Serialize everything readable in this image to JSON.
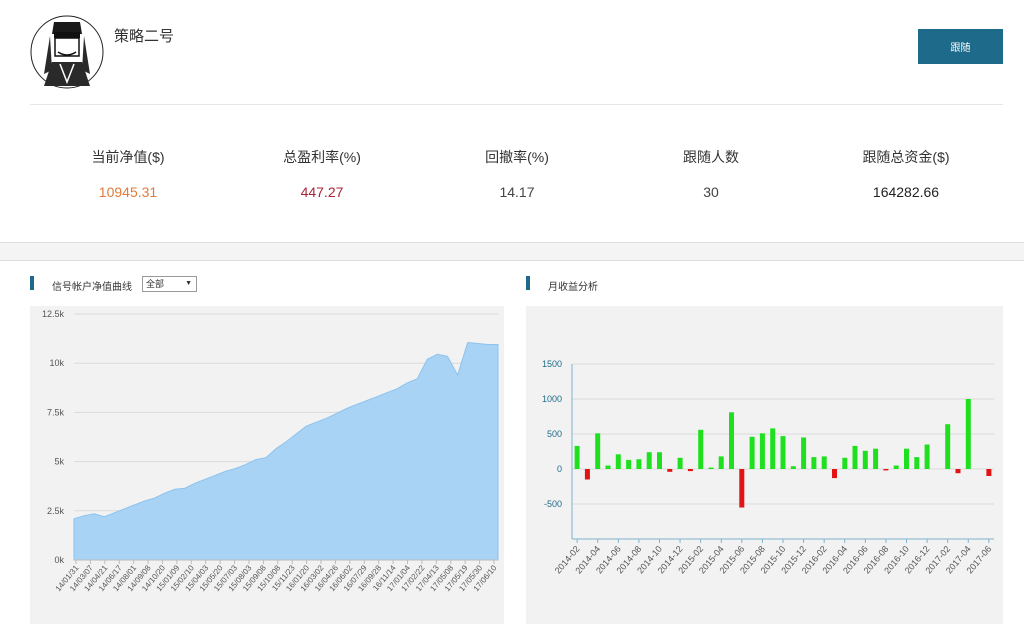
{
  "header": {
    "strategy_name": "策略二号",
    "follow_label": "跟随"
  },
  "stats": [
    {
      "label": "当前净值($)",
      "value": "10945.31",
      "color": "#e07b39"
    },
    {
      "label": "总盈利率(%)",
      "value": "447.27",
      "color": "#a8243a"
    },
    {
      "label": "回撤率(%)",
      "value": "14.17",
      "color": "#444444"
    },
    {
      "label": "跟随人数",
      "value": "30",
      "color": "#444444"
    },
    {
      "label": "跟随总资金($)",
      "value": "164282.66",
      "color": "#222222"
    }
  ],
  "equity_section": {
    "title": "信号帐户净值曲线",
    "range_select": "全部"
  },
  "monthly_section": {
    "title": "月收益分析"
  },
  "colors": {
    "accent": "#1e6a8a",
    "area_fill": "#a9d3f5",
    "area_line": "#8cc3ee",
    "positive_bar": "#1ee01e",
    "negative_bar": "#e01414"
  },
  "chart_data": [
    {
      "type": "area",
      "series_color": "#a9d3f5",
      "ylim": [
        0,
        12500
      ],
      "yticks": [
        0,
        2500,
        5000,
        7500,
        10000,
        12500
      ],
      "ytick_labels": [
        "0k",
        "2.5k",
        "5k",
        "7.5k",
        "10k",
        "12.5k"
      ],
      "xtick_labels": [
        "14/01/31",
        "14/03/07",
        "14/04/21",
        "14/06/17",
        "14/08/01",
        "14/09/08",
        "14/10/20",
        "15/01/09",
        "15/02/10",
        "15/04/03",
        "15/05/20",
        "15/07/03",
        "15/08/03",
        "15/09/08",
        "15/10/08",
        "15/11/23",
        "16/01/20",
        "16/03/02",
        "16/04/26",
        "16/06/02",
        "16/07/29",
        "16/09/28",
        "16/11/14",
        "17/01/04",
        "17/02/22",
        "17/04/13",
        "17/05/08",
        "17/05/19",
        "17/05/30",
        "17/06/10"
      ],
      "values": [
        2100,
        2250,
        2350,
        2200,
        2400,
        2600,
        2800,
        3000,
        3150,
        3400,
        3600,
        3650,
        3900,
        4100,
        4300,
        4500,
        4650,
        4850,
        5100,
        5200,
        5650,
        6000,
        6400,
        6800,
        7000,
        7200,
        7450,
        7700,
        7900,
        8100,
        8300,
        8500,
        8700,
        9000,
        9200,
        10200,
        10450,
        10350,
        9400,
        11050,
        11000,
        10950,
        10950
      ]
    },
    {
      "type": "bar",
      "ylim": [
        -1000,
        1500
      ],
      "yticks": [
        -500,
        0,
        500,
        1000,
        1500
      ],
      "ytick_labels": [
        "-500",
        "0",
        "500",
        "1000",
        "1500"
      ],
      "xtick_labels": [
        "2014-02",
        "2014-04",
        "2014-06",
        "2014-08",
        "2014-10",
        "2014-12",
        "2015-02",
        "2015-04",
        "2015-06",
        "2015-08",
        "2015-10",
        "2015-12",
        "2016-02",
        "2016-04",
        "2016-06",
        "2016-08",
        "2016-10",
        "2016-12",
        "2017-02",
        "2017-04",
        "2017-06"
      ],
      "categories": [
        "2014-02",
        "2014-03",
        "2014-04",
        "2014-05",
        "2014-06",
        "2014-07",
        "2014-08",
        "2014-09",
        "2014-10",
        "2014-11",
        "2014-12",
        "2015-01",
        "2015-02",
        "2015-03",
        "2015-04",
        "2015-05",
        "2015-06",
        "2015-07",
        "2015-08",
        "2015-09",
        "2015-10",
        "2015-11",
        "2015-12",
        "2016-01",
        "2016-02",
        "2016-03",
        "2016-04",
        "2016-05",
        "2016-06",
        "2016-07",
        "2016-08",
        "2016-09",
        "2016-10",
        "2016-11",
        "2016-12",
        "2017-01",
        "2017-02",
        "2017-03",
        "2017-04",
        "2017-05",
        "2017-06"
      ],
      "values": [
        330,
        -150,
        510,
        50,
        210,
        130,
        140,
        240,
        240,
        -40,
        160,
        -30,
        560,
        20,
        180,
        810,
        -550,
        460,
        510,
        580,
        470,
        40,
        450,
        170,
        180,
        -130,
        160,
        330,
        260,
        290,
        -20,
        50,
        290,
        170,
        350,
        0,
        640,
        -60,
        1000,
        0,
        -100
      ]
    }
  ]
}
